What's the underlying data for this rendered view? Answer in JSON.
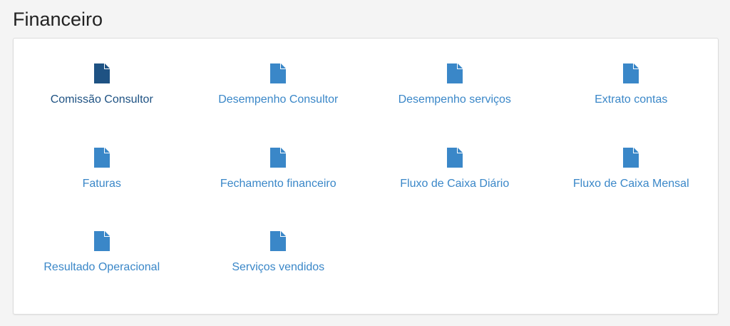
{
  "page": {
    "title": "Financeiro"
  },
  "colors": {
    "link": "#3a87c8",
    "active_link": "#1e5283"
  },
  "reports": [
    {
      "label": "Comissão Consultor",
      "icon": "file-icon",
      "active": true
    },
    {
      "label": "Desempenho Consultor",
      "icon": "file-icon",
      "active": false
    },
    {
      "label": "Desempenho serviços",
      "icon": "file-icon",
      "active": false
    },
    {
      "label": "Extrato contas",
      "icon": "file-icon",
      "active": false
    },
    {
      "label": "Faturas",
      "icon": "file-icon",
      "active": false
    },
    {
      "label": "Fechamento financeiro",
      "icon": "file-icon",
      "active": false
    },
    {
      "label": "Fluxo de Caixa Diário",
      "icon": "file-icon",
      "active": false
    },
    {
      "label": "Fluxo de Caixa Mensal",
      "icon": "file-icon",
      "active": false
    },
    {
      "label": "Resultado Operacional",
      "icon": "file-icon",
      "active": false
    },
    {
      "label": "Serviços vendidos",
      "icon": "file-icon",
      "active": false
    }
  ]
}
